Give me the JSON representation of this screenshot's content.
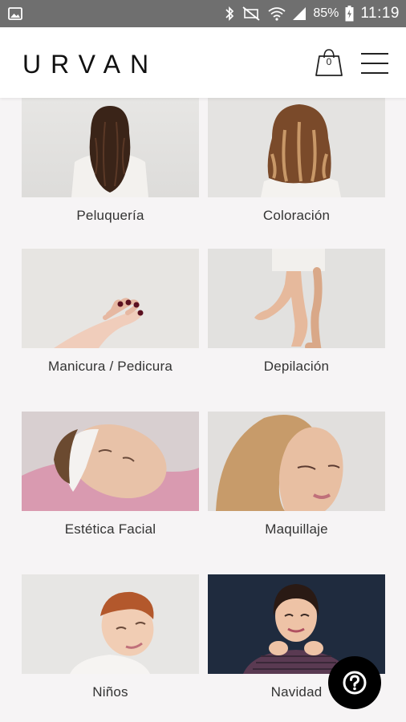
{
  "status_bar": {
    "battery": "85%",
    "time": "11:19",
    "icons": [
      "image-icon",
      "bluetooth-icon",
      "mute-icon",
      "wifi-icon",
      "signal-icon",
      "battery-icon"
    ]
  },
  "header": {
    "logo": "URVAN",
    "cart_count": "0",
    "cart_icon": "shopping-bag-icon",
    "menu_icon": "hamburger-menu-icon"
  },
  "categories": [
    {
      "label": "Peluquería"
    },
    {
      "label": "Coloración"
    },
    {
      "label": "Manicura / Pedicura"
    },
    {
      "label": "Depilación"
    },
    {
      "label": "Estética Facial"
    },
    {
      "label": "Maquillaje"
    },
    {
      "label": "Niños"
    },
    {
      "label": "Navidad"
    }
  ],
  "help_button": {
    "icon": "question-mark-icon"
  },
  "colors": {
    "background": "#f6f4f5",
    "header": "#ffffff",
    "text": "#333333",
    "help_button": "#000000"
  }
}
